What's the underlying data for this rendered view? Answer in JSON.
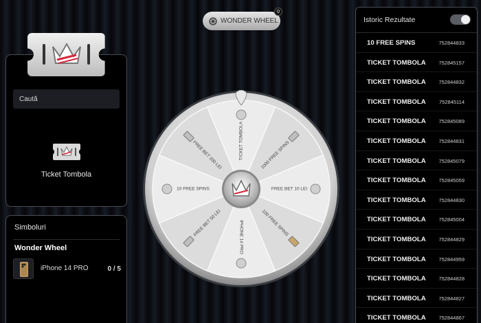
{
  "search": {
    "placeholder": "Caută"
  },
  "selected_item": {
    "label": "Ticket Tombola"
  },
  "symbols": {
    "title": "Simboluri",
    "wheel_name": "Wonder Wheel",
    "prizes": [
      {
        "name": "iPhone 14 PRO",
        "count": "0 / 5"
      }
    ]
  },
  "wheel_button": {
    "label": "WONDER WHEEL",
    "badge": "0"
  },
  "wheel": {
    "segments": [
      "TICKET TOMBOLA",
      "1000 FREE SPINS",
      "FREE BET 10 LEI",
      "100 FREE SPINS",
      "IPHONE 14 PRO",
      "FREE BET 50 LEI",
      "10 FREE SPINS",
      "FREE BET 200 LEI"
    ]
  },
  "history": {
    "title": "Istoric Rezultate",
    "rows": [
      {
        "label": "10 FREE SPINS",
        "id": "752844833"
      },
      {
        "label": "TICKET TOMBOLA",
        "id": "752845157"
      },
      {
        "label": "TICKET TOMBOLA",
        "id": "752844832"
      },
      {
        "label": "TICKET TOMBOLA",
        "id": "752845114"
      },
      {
        "label": "TICKET TOMBOLA",
        "id": "752845089"
      },
      {
        "label": "TICKET TOMBOLA",
        "id": "752844831"
      },
      {
        "label": "TICKET TOMBOLA",
        "id": "752845079"
      },
      {
        "label": "TICKET TOMBOLA",
        "id": "752845059"
      },
      {
        "label": "TICKET TOMBOLA",
        "id": "752844830"
      },
      {
        "label": "TICKET TOMBOLA",
        "id": "752845004"
      },
      {
        "label": "TICKET TOMBOLA",
        "id": "752844829"
      },
      {
        "label": "TICKET TOMBOLA",
        "id": "752844959"
      },
      {
        "label": "TICKET TOMBOLA",
        "id": "752844828"
      },
      {
        "label": "TICKET TOMBOLA",
        "id": "752844827"
      },
      {
        "label": "TICKET TOMBOLA",
        "id": "752844867"
      }
    ]
  }
}
